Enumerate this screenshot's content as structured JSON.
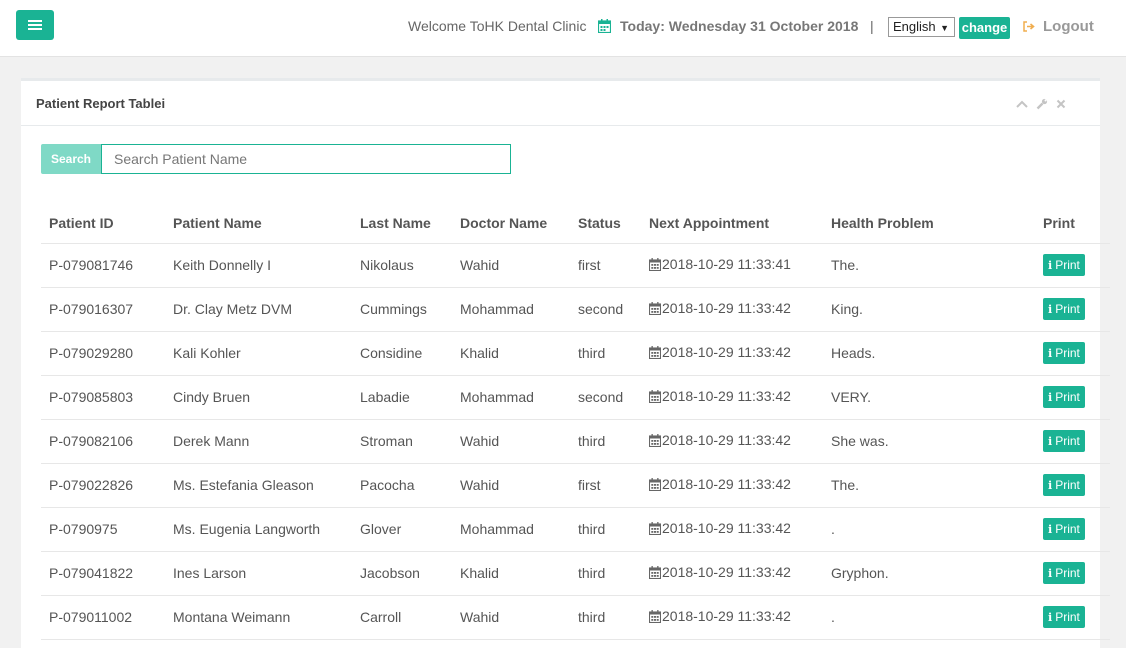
{
  "header": {
    "welcome": "Welcome ToHK Dental Clinic",
    "today": "Today: Wednesday 31 October 2018",
    "separator": "|",
    "language_selected": "English",
    "change_label": "change",
    "logout_label": "Logout"
  },
  "panel": {
    "title": "Patient Report Tablei"
  },
  "search": {
    "label": "Search",
    "placeholder": "Search Patient Name"
  },
  "table": {
    "columns": [
      "Patient ID",
      "Patient Name",
      "Last Name",
      "Doctor Name",
      "Status",
      "Next Appointment",
      "Health Problem",
      "Print"
    ],
    "print_label": "Print",
    "rows": [
      {
        "id": "P-079081746",
        "name": "Keith Donnelly I",
        "last": "Nikolaus",
        "doctor": "Wahid",
        "status": "first",
        "appt": "2018-10-29 11:33:41",
        "problem": "The."
      },
      {
        "id": "P-079016307",
        "name": "Dr. Clay Metz DVM",
        "last": "Cummings",
        "doctor": "Mohammad",
        "status": "second",
        "appt": "2018-10-29 11:33:42",
        "problem": "King."
      },
      {
        "id": "P-079029280",
        "name": "Kali Kohler",
        "last": "Considine",
        "doctor": "Khalid",
        "status": "third",
        "appt": "2018-10-29 11:33:42",
        "problem": "Heads."
      },
      {
        "id": "P-079085803",
        "name": "Cindy Bruen",
        "last": "Labadie",
        "doctor": "Mohammad",
        "status": "second",
        "appt": "2018-10-29 11:33:42",
        "problem": "VERY."
      },
      {
        "id": "P-079082106",
        "name": "Derek Mann",
        "last": "Stroman",
        "doctor": "Wahid",
        "status": "third",
        "appt": "2018-10-29 11:33:42",
        "problem": "She was."
      },
      {
        "id": "P-079022826",
        "name": "Ms. Estefania Gleason",
        "last": "Pacocha",
        "doctor": "Wahid",
        "status": "first",
        "appt": "2018-10-29 11:33:42",
        "problem": "The."
      },
      {
        "id": "P-0790975",
        "name": "Ms. Eugenia Langworth",
        "last": "Glover",
        "doctor": "Mohammad",
        "status": "third",
        "appt": "2018-10-29 11:33:42",
        "problem": "."
      },
      {
        "id": "P-079041822",
        "name": "Ines Larson",
        "last": "Jacobson",
        "doctor": "Khalid",
        "status": "third",
        "appt": "2018-10-29 11:33:42",
        "problem": "Gryphon."
      },
      {
        "id": "P-079011002",
        "name": "Montana Weimann",
        "last": "Carroll",
        "doctor": "Wahid",
        "status": "third",
        "appt": "2018-10-29 11:33:42",
        "problem": "."
      }
    ]
  },
  "colors": {
    "accent": "#1ab394",
    "search_label_bg": "#7fd9c6"
  },
  "icons": {
    "menu": "bars-icon",
    "calendar": "calendar-icon",
    "logout": "sign-out-icon",
    "collapse": "chevron-up-icon",
    "config": "wrench-icon",
    "close": "close-icon",
    "print": "info-icon"
  }
}
